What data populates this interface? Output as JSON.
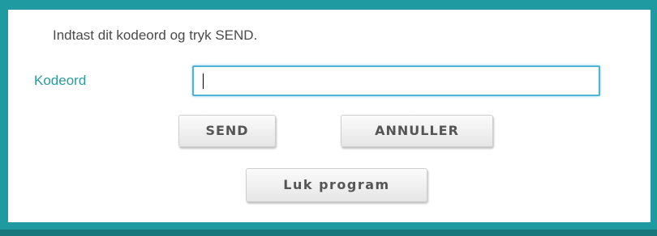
{
  "colors": {
    "frame": "#1e9aa0",
    "label": "#2a9aa2",
    "input_focus_border": "#4db3d9"
  },
  "login": {
    "instruction": "Indtast dit kodeord og tryk SEND.",
    "password_label": "Kodeord",
    "password_value": ""
  },
  "buttons": {
    "send": "SEND",
    "cancel": "ANNULLER",
    "close_program": "Luk program"
  }
}
